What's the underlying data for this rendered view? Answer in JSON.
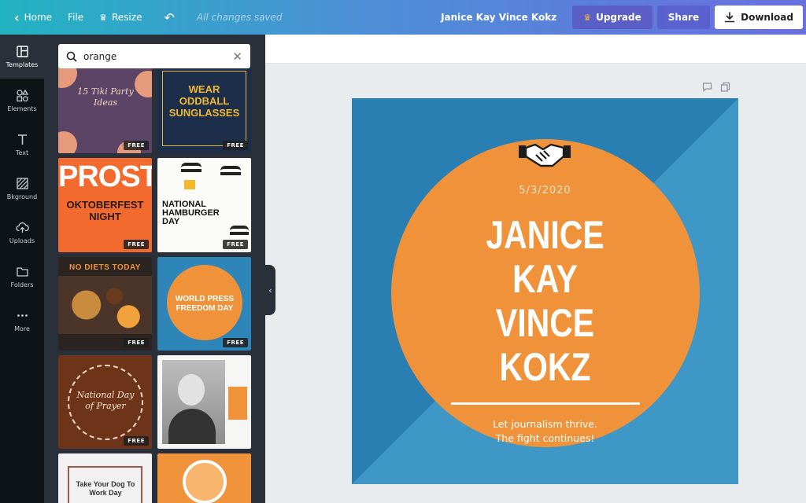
{
  "topbar": {
    "home_label": "Home",
    "file_label": "File",
    "resize_label": "Resize",
    "saved_status": "All changes saved",
    "doc_title": "Janice Kay Vince Kokz",
    "upgrade_label": "Upgrade",
    "share_label": "Share",
    "download_label": "Download"
  },
  "rail": {
    "items": [
      {
        "label": "Templates",
        "icon": "templates-icon",
        "active": true
      },
      {
        "label": "Elements",
        "icon": "elements-icon"
      },
      {
        "label": "Text",
        "icon": "text-icon"
      },
      {
        "label": "Bkground",
        "icon": "background-icon"
      },
      {
        "label": "Uploads",
        "icon": "uploads-icon"
      },
      {
        "label": "Folders",
        "icon": "folders-icon"
      },
      {
        "label": "More",
        "icon": "more-icon"
      }
    ]
  },
  "panel": {
    "search_value": "orange",
    "free_label": "FREE",
    "templates": [
      {
        "title": "15 Tiki Party Ideas",
        "free": true
      },
      {
        "title": "WEAR ODDBALL SUNGLASSES",
        "free": true
      },
      {
        "title": "PROST!",
        "subtitle": "OKTOBERFEST NIGHT",
        "free": true
      },
      {
        "title": "NATIONAL HAMBURGER DAY",
        "free": true
      },
      {
        "title": "NO DIETS TODAY",
        "free": true
      },
      {
        "title": "WORLD PRESS FREEDOM DAY",
        "free": true
      },
      {
        "title": "National Day of Prayer",
        "free": true
      },
      {
        "title": "",
        "free": false
      },
      {
        "title": "Take Your Dog To Work Day",
        "free": false
      },
      {
        "title": "",
        "free": false
      }
    ]
  },
  "design": {
    "date": "5/3/2020",
    "name_lines": [
      "JANICE",
      "KAY",
      "VINCE",
      "KOKZ"
    ],
    "tagline_1": "Let journalism thrive.",
    "tagline_2": "The fight continues!",
    "colors": {
      "background": "#2e86b8",
      "circle": "#f0923a"
    }
  },
  "colors": {
    "rail": "#0e1318",
    "panel": "#293039",
    "accent": "#f0923a"
  }
}
